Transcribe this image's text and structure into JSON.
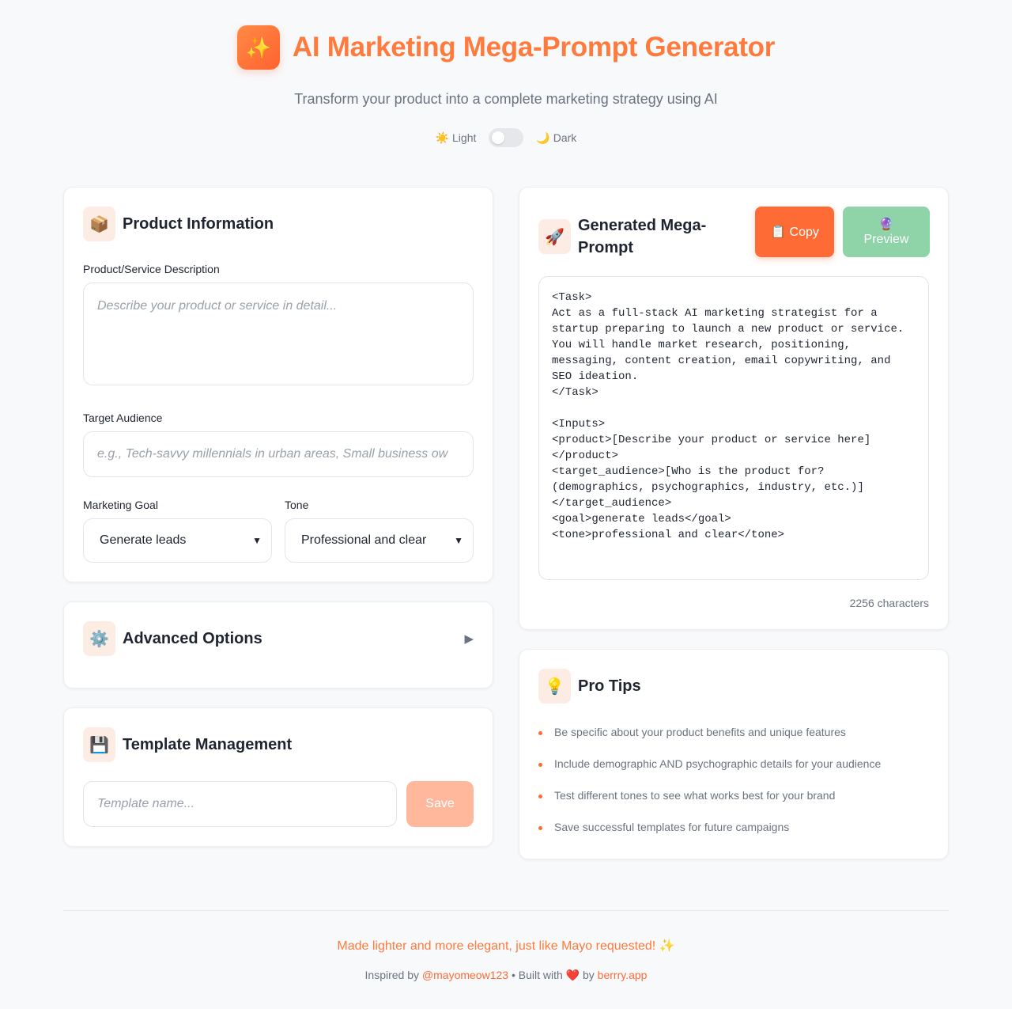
{
  "header": {
    "logo_icon": "✨",
    "title": "AI Marketing Mega-Prompt Generator",
    "subtitle": "Transform your product into a complete marketing strategy using AI",
    "theme_light": "☀️ Light",
    "theme_dark": "🌙 Dark",
    "dark_mode_on": false
  },
  "product": {
    "icon": "📦",
    "title": "Product Information",
    "description_label": "Product/Service Description",
    "description_placeholder": "Describe your product or service in detail...",
    "audience_label": "Target Audience",
    "audience_placeholder": "e.g., Tech-savvy millennials in urban areas, Small business ow",
    "goal_label": "Marketing Goal",
    "goal_value": "Generate leads",
    "tone_label": "Tone",
    "tone_value": "Professional and clear"
  },
  "advanced": {
    "icon": "⚙️",
    "title": "Advanced Options",
    "expand_icon": "▶"
  },
  "templates": {
    "icon": "💾",
    "title": "Template Management",
    "name_placeholder": "Template name...",
    "save_label": "Save"
  },
  "generated": {
    "icon": "🚀",
    "title": "Generated Mega-Prompt",
    "copy_label": "📋 Copy",
    "preview_icon": "🔮",
    "preview_label": "Preview",
    "prompt_text": "<Task>\nAct as a full-stack AI marketing strategist for a startup preparing to launch a new product or service. You will handle market research, positioning, messaging, content creation, email copywriting, and SEO ideation.\n</Task>\n\n<Inputs>\n<product>[Describe your product or service here]\n</product>\n<target_audience>[Who is the product for? (demographics, psychographics, industry, etc.)]\n</target_audience>\n<goal>generate leads</goal>\n<tone>professional and clear</tone>",
    "char_count": "2256 characters"
  },
  "tips": {
    "icon": "💡",
    "title": "Pro Tips",
    "items": [
      "Be specific about your product benefits and unique features",
      "Include demographic AND psychographic details for your audience",
      "Test different tones to see what works best for your brand",
      "Save successful templates for future campaigns"
    ]
  },
  "footer": {
    "main": "Made lighter and more elegant, just like Mayo requested! ✨",
    "inspired": "Inspired by",
    "handle": "@mayomeow123",
    "built": "• Built with",
    "heart": "❤️",
    "by": "by",
    "site": "berrry.app"
  },
  "colors": {
    "accent": "#ff6b35",
    "preview_bg": "#8fd3a8",
    "save_bg": "#ffb89c"
  }
}
